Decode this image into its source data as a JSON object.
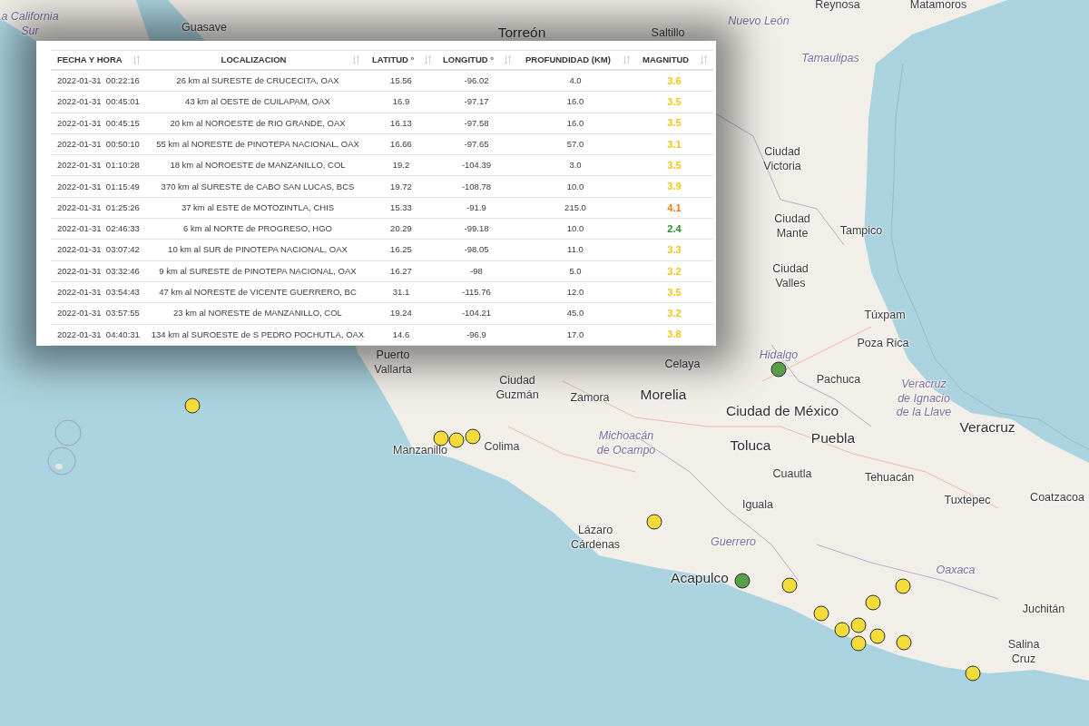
{
  "table": {
    "columns": [
      {
        "label": "FECHA Y HORA"
      },
      {
        "label": "LOCALIZACION"
      },
      {
        "label": "LATITUD °"
      },
      {
        "label": "LONGITUD °"
      },
      {
        "label": "PROFUNDIDAD (KM)"
      },
      {
        "label": "MAGNITUD"
      }
    ],
    "rows": [
      {
        "date_time": "2022-01-31  00:22:16",
        "location": "26 km al SURESTE de CRUCECITA, OAX",
        "latitude": "15.56",
        "longitude": "-96.02",
        "depth": "4.0",
        "magnitude": "3.6",
        "color": "#f5c518"
      },
      {
        "date_time": "2022-01-31  00:45:01",
        "location": "43 km al OESTE de CUILAPAM, OAX",
        "latitude": "16.9",
        "longitude": "-97.17",
        "depth": "16.0",
        "magnitude": "3.5",
        "color": "#f5c518"
      },
      {
        "date_time": "2022-01-31  00:45:15",
        "location": "20 km al NOROESTE de RIO GRANDE, OAX",
        "latitude": "16.13",
        "longitude": "-97.58",
        "depth": "16.0",
        "magnitude": "3.5",
        "color": "#f5c518"
      },
      {
        "date_time": "2022-01-31  00:50:10",
        "location": "55 km al NORESTE de PINOTEPA NACIONAL, OAX",
        "latitude": "16.66",
        "longitude": "-97.65",
        "depth": "57.0",
        "magnitude": "3.1",
        "color": "#f5c518"
      },
      {
        "date_time": "2022-01-31  01:10:28",
        "location": "18 km al NOROESTE de MANZANILLO, COL",
        "latitude": "19.2",
        "longitude": "-104.39",
        "depth": "3.0",
        "magnitude": "3.5",
        "color": "#f5c518"
      },
      {
        "date_time": "2022-01-31  01:15:49",
        "location": "370 km al SURESTE de CABO SAN LUCAS, BCS",
        "latitude": "19.72",
        "longitude": "-108.78",
        "depth": "10.0",
        "magnitude": "3.9",
        "color": "#f5c518"
      },
      {
        "date_time": "2022-01-31  01:25:26",
        "location": "37 km al ESTE de MOTOZINTLA, CHIS",
        "latitude": "15.33",
        "longitude": "-91.9",
        "depth": "215.0",
        "magnitude": "4.1",
        "color": "#f27c0c"
      },
      {
        "date_time": "2022-01-31  02:46:33",
        "location": "6 km al NORTE de PROGRESO, HGO",
        "latitude": "20.29",
        "longitude": "-99.18",
        "depth": "10.0",
        "magnitude": "2.4",
        "color": "#2e8a22"
      },
      {
        "date_time": "2022-01-31  03:07:42",
        "location": "10 km al SUR de PINOTEPA NACIONAL, OAX",
        "latitude": "16.25",
        "longitude": "-98.05",
        "depth": "11.0",
        "magnitude": "3.3",
        "color": "#f5c518"
      },
      {
        "date_time": "2022-01-31  03:32:46",
        "location": "9 km al SURESTE de PINOTEPA NACIONAL, OAX",
        "latitude": "16.27",
        "longitude": "-98",
        "depth": "5.0",
        "magnitude": "3.2",
        "color": "#f5c518"
      },
      {
        "date_time": "2022-01-31  03:54:43",
        "location": "47 km al NORESTE de VICENTE GUERRERO, BC",
        "latitude": "31.1",
        "longitude": "-115.76",
        "depth": "12.0",
        "magnitude": "3.5",
        "color": "#f5c518"
      },
      {
        "date_time": "2022-01-31  03:57:55",
        "location": "23 km al NORESTE de MANZANILLO, COL",
        "latitude": "19.24",
        "longitude": "-104.21",
        "depth": "45.0",
        "magnitude": "3.2",
        "color": "#f5c518"
      },
      {
        "date_time": "2022-01-31  04:40:31",
        "location": "134 km al SUROESTE de S PEDRO POCHUTLA, OAX",
        "latitude": "14.6",
        "longitude": "-96.9",
        "depth": "17.0",
        "magnitude": "3.8",
        "color": "#f5c518"
      }
    ]
  },
  "map": {
    "labels": [
      {
        "text": "a California Sur",
        "kind": "state"
      },
      {
        "text": "Guasave",
        "kind": "city"
      },
      {
        "text": "Torreón",
        "kind": "major_city"
      },
      {
        "text": "Saltillo",
        "kind": "city"
      },
      {
        "text": "Reynosa",
        "kind": "city"
      },
      {
        "text": "Matamoros",
        "kind": "city"
      },
      {
        "text": "Nuevo León",
        "kind": "state"
      },
      {
        "text": "Tamaulipas",
        "kind": "state"
      },
      {
        "text": "Ciudad Victoria",
        "kind": "city"
      },
      {
        "text": "Ciudad Mante",
        "kind": "city"
      },
      {
        "text": "Tampico",
        "kind": "city"
      },
      {
        "text": "Ciudad Valles",
        "kind": "city"
      },
      {
        "text": "Túxpam",
        "kind": "city"
      },
      {
        "text": "Poza Rica",
        "kind": "city"
      },
      {
        "text": "Puerto Vallarta",
        "kind": "city"
      },
      {
        "text": "Celaya",
        "kind": "city"
      },
      {
        "text": "Hidalgo",
        "kind": "state"
      },
      {
        "text": "Ciudad Guzmán",
        "kind": "city"
      },
      {
        "text": "Pachuca",
        "kind": "city"
      },
      {
        "text": "Zamora",
        "kind": "city"
      },
      {
        "text": "Morelia",
        "kind": "major_city"
      },
      {
        "text": "Ciudad de México",
        "kind": "major_city"
      },
      {
        "text": "Veracruz de Ignacio de la Llave",
        "kind": "state"
      },
      {
        "text": "Manzanillo",
        "kind": "city"
      },
      {
        "text": "Colima",
        "kind": "city"
      },
      {
        "text": "Michoacán de Ocampo",
        "kind": "state"
      },
      {
        "text": "Toluca",
        "kind": "major_city"
      },
      {
        "text": "Puebla",
        "kind": "major_city"
      },
      {
        "text": "Veracruz",
        "kind": "major_city"
      },
      {
        "text": "Cuautla",
        "kind": "city"
      },
      {
        "text": "Tehuacán",
        "kind": "city"
      },
      {
        "text": "Iguala",
        "kind": "city"
      },
      {
        "text": "Tuxtepec",
        "kind": "city"
      },
      {
        "text": "Coatzacoa",
        "kind": "city"
      },
      {
        "text": "Lázaro Cárdenas",
        "kind": "city"
      },
      {
        "text": "Guerrero",
        "kind": "state"
      },
      {
        "text": "Acapulco",
        "kind": "major_city"
      },
      {
        "text": "Oaxaca",
        "kind": "state"
      },
      {
        "text": "Juchitán",
        "kind": "city"
      },
      {
        "text": "Salina Cruz",
        "kind": "city"
      }
    ],
    "markers": [
      {
        "color": "#f3dc3a"
      },
      {
        "color": "#f3dc3a"
      },
      {
        "color": "#f3dc3a"
      },
      {
        "color": "#f3dc3a"
      },
      {
        "color": "#5a9e4a"
      },
      {
        "color": "#f3dc3a"
      },
      {
        "color": "#5a9e4a"
      },
      {
        "color": "#f3dc3a"
      },
      {
        "color": "#f3dc3a"
      },
      {
        "color": "#f3dc3a"
      },
      {
        "color": "#f3dc3a"
      },
      {
        "color": "#f3dc3a"
      },
      {
        "color": "#f3dc3a"
      },
      {
        "color": "#f3dc3a"
      },
      {
        "color": "#f3dc3a"
      },
      {
        "color": "#f3dc3a"
      },
      {
        "color": "#f3dc3a"
      }
    ]
  }
}
